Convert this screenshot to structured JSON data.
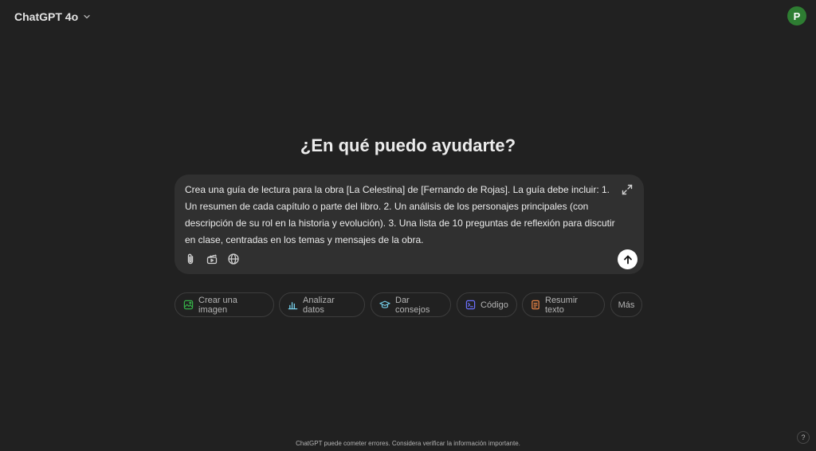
{
  "header": {
    "model_name": "ChatGPT 4o",
    "avatar_initial": "P"
  },
  "main": {
    "heading": "¿En qué puedo ayudarte?"
  },
  "composer": {
    "text": "Crea una guía de lectura para la obra [La Celestina] de [Fernando de Rojas]. La guía debe incluir: 1. Un resumen de cada capítulo o parte del libro. 2. Un análisis de los personajes principales (con descripción de su rol en la historia y evolución). 3. Una lista de 10 preguntas de reflexión para discutir en clase, centradas en los temas y mensajes de la obra.",
    "tools": [
      "paperclip-icon",
      "clapperboard-icon",
      "globe-icon"
    ]
  },
  "suggestions": {
    "items": [
      {
        "label": "Crear una imagen",
        "icon": "image-icon",
        "color": "#35ae47"
      },
      {
        "label": "Analizar datos",
        "icon": "bar-chart-icon",
        "color": "#76d0eb"
      },
      {
        "label": "Dar consejos",
        "icon": "graduation-cap-icon",
        "color": "#76d0eb"
      },
      {
        "label": "Código",
        "icon": "terminal-icon",
        "color": "#6c71ff"
      },
      {
        "label": "Resumir texto",
        "icon": "document-icon",
        "color": "#ea8444"
      }
    ],
    "more_label": "Más"
  },
  "footer": {
    "disclaimer": "ChatGPT puede cometer errores. Considera verificar la información importante.",
    "help_label": "?"
  }
}
